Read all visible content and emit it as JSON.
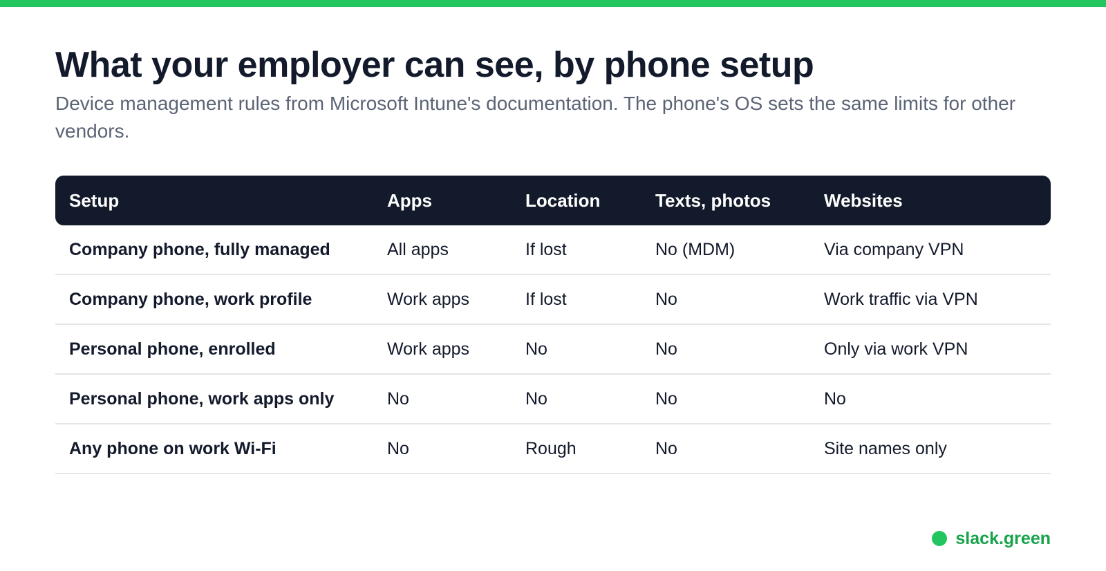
{
  "colors": {
    "accent": "#22c55e",
    "brand_text": "#16a34a",
    "header_bg": "#131a2b",
    "text": "#131a2b",
    "muted": "#5b6475",
    "divider": "#e3e5e9"
  },
  "header": {
    "title": "What your employer can see, by phone setup",
    "subtitle": "Device management rules from Microsoft Intune's documentation. The phone's OS sets the same limits for other vendors."
  },
  "table": {
    "columns": [
      "Setup",
      "Apps",
      "Location",
      "Texts, photos",
      "Websites"
    ],
    "rows": [
      [
        "Company phone, fully managed",
        "All apps",
        "If lost",
        "No (MDM)",
        "Via company VPN"
      ],
      [
        "Company phone, work profile",
        "Work apps",
        "If lost",
        "No",
        "Work traffic via VPN"
      ],
      [
        "Personal phone, enrolled",
        "Work apps",
        "No",
        "No",
        "Only via work VPN"
      ],
      [
        "Personal phone, work apps only",
        "No",
        "No",
        "No",
        "No"
      ],
      [
        "Any phone on work Wi-Fi",
        "No",
        "Rough",
        "No",
        "Site names only"
      ]
    ]
  },
  "footer": {
    "brand": "slack.green"
  }
}
